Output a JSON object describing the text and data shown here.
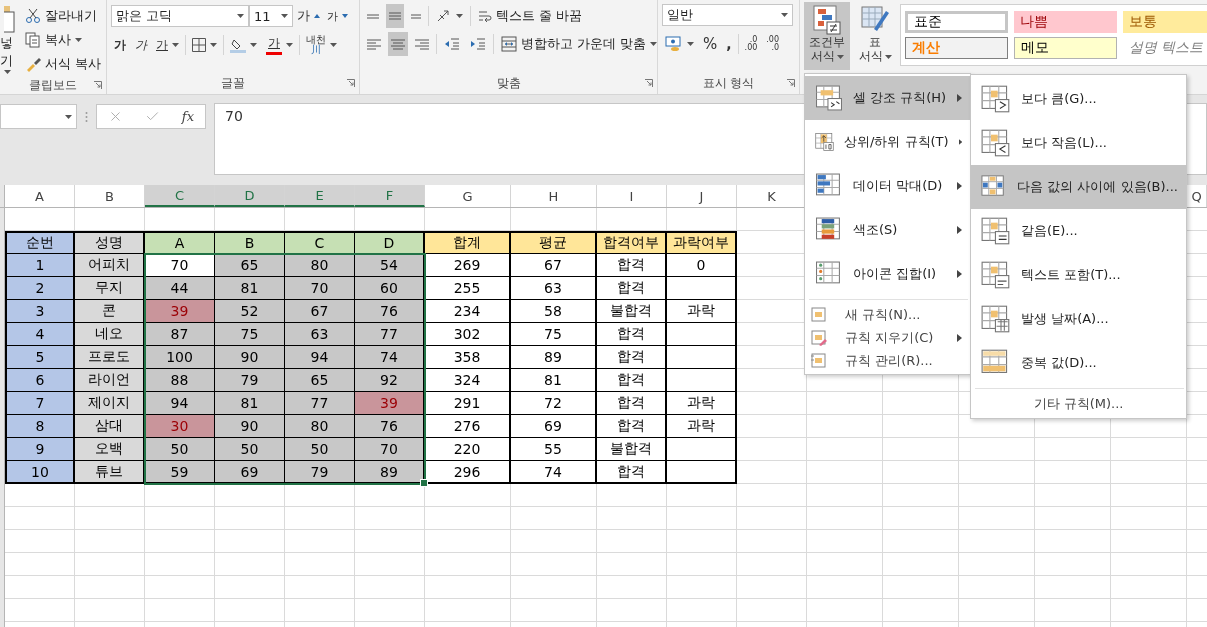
{
  "ribbon": {
    "clipboard": {
      "paste": "넣기",
      "cut": "잘라내기",
      "copy": "복사",
      "format_painter": "서식 복사",
      "label": "클립보드"
    },
    "font": {
      "font_name": "맑은 고딕",
      "font_size": "11",
      "grow": "가",
      "shrink": "가",
      "bold": "가",
      "italic": "가",
      "underline": "가",
      "font_color": "가",
      "phonetic": "내천",
      "phonetic_sub": "川",
      "label": "글꼴"
    },
    "alignment": {
      "vertical": [
        {
          "selected": false
        },
        {
          "selected": true
        },
        {
          "selected": false
        }
      ],
      "horizontal": [
        {
          "selected": false
        },
        {
          "selected": true
        },
        {
          "selected": false
        }
      ],
      "wrap_text": "텍스트 줄 바꿈",
      "merge_center": "병합하고 가운데 맞춤",
      "label": "맞춤"
    },
    "number": {
      "format": "일반",
      "percent": "%",
      "comma": ",",
      "increase_decimal": [
        ".0",
        ".00"
      ],
      "decrease_decimal": [
        ".00",
        ".0"
      ],
      "label": "표시 형식"
    },
    "styles": {
      "conditional_formatting": {
        "lines": [
          "조건부",
          "서식"
        ],
        "selected": true
      },
      "table_format": {
        "lines": [
          "표",
          "서식"
        ],
        "selected": false
      },
      "cell_styles": [
        {
          "label": "표준",
          "kind": "normal"
        },
        {
          "label": "나쁨",
          "kind": "bad"
        },
        {
          "label": "보통",
          "kind": "neutral"
        },
        {
          "label": "계산",
          "kind": "calculation"
        },
        {
          "label": "메모",
          "kind": "note"
        },
        {
          "label": "설명 텍스트",
          "kind": "explanatory"
        }
      ]
    }
  },
  "formula_bar": {
    "function_label": "fx",
    "value": "70"
  },
  "columns": [
    {
      "label": "A",
      "selected": false
    },
    {
      "label": "B",
      "selected": false
    },
    {
      "label": "C",
      "selected": true
    },
    {
      "label": "D",
      "selected": true
    },
    {
      "label": "E",
      "selected": true
    },
    {
      "label": "F",
      "selected": true
    },
    {
      "label": "G",
      "selected": false
    },
    {
      "label": "H",
      "selected": false
    },
    {
      "label": "I",
      "selected": false
    },
    {
      "label": "J",
      "selected": false
    },
    {
      "label": "K",
      "selected": false
    },
    {
      "label": "Q",
      "selected": false
    }
  ],
  "table": {
    "header": [
      {
        "label": "순번",
        "kind": "number"
      },
      {
        "label": "성명",
        "kind": "name"
      },
      {
        "label": "A",
        "kind": "score"
      },
      {
        "label": "B",
        "kind": "score"
      },
      {
        "label": "C",
        "kind": "score"
      },
      {
        "label": "D",
        "kind": "score"
      },
      {
        "label": "합계",
        "kind": "result"
      },
      {
        "label": "평균",
        "kind": "result"
      },
      {
        "label": "합격여부",
        "kind": "result"
      },
      {
        "label": "과락여부",
        "kind": "result"
      }
    ],
    "rows": [
      {
        "no": "1",
        "name": "어피치",
        "scores": [
          {
            "value": "70",
            "selected": true,
            "active": true,
            "highlighted": false
          },
          {
            "value": "65",
            "selected": true,
            "active": false,
            "highlighted": false
          },
          {
            "value": "80",
            "selected": true,
            "active": false,
            "highlighted": false
          },
          {
            "value": "54",
            "selected": true,
            "active": false,
            "highlighted": false
          }
        ],
        "total": "269",
        "average": "67",
        "pass": "합격",
        "fail": "0"
      },
      {
        "no": "2",
        "name": "무지",
        "scores": [
          {
            "value": "44",
            "selected": true,
            "active": false,
            "highlighted": false
          },
          {
            "value": "81",
            "selected": true,
            "active": false,
            "highlighted": false
          },
          {
            "value": "70",
            "selected": true,
            "active": false,
            "highlighted": false
          },
          {
            "value": "60",
            "selected": true,
            "active": false,
            "highlighted": false
          }
        ],
        "total": "255",
        "average": "63",
        "pass": "합격"
      },
      {
        "no": "3",
        "name": "콘",
        "scores": [
          {
            "value": "39",
            "selected": true,
            "active": false,
            "highlighted": true
          },
          {
            "value": "52",
            "selected": true,
            "active": false,
            "highlighted": false
          },
          {
            "value": "67",
            "selected": true,
            "active": false,
            "highlighted": false
          },
          {
            "value": "76",
            "selected": true,
            "active": false,
            "highlighted": false
          }
        ],
        "total": "234",
        "average": "58",
        "pass": "불합격",
        "fail": "과락"
      },
      {
        "no": "4",
        "name": "네오",
        "scores": [
          {
            "value": "87",
            "selected": true,
            "active": false,
            "highlighted": false
          },
          {
            "value": "75",
            "selected": true,
            "active": false,
            "highlighted": false
          },
          {
            "value": "63",
            "selected": true,
            "active": false,
            "highlighted": false
          },
          {
            "value": "77",
            "selected": true,
            "active": false,
            "highlighted": false
          }
        ],
        "total": "302",
        "average": "75",
        "pass": "합격"
      },
      {
        "no": "5",
        "name": "프로도",
        "scores": [
          {
            "value": "100",
            "selected": true,
            "active": false,
            "highlighted": false
          },
          {
            "value": "90",
            "selected": true,
            "active": false,
            "highlighted": false
          },
          {
            "value": "94",
            "selected": true,
            "active": false,
            "highlighted": false
          },
          {
            "value": "74",
            "selected": true,
            "active": false,
            "highlighted": false
          }
        ],
        "total": "358",
        "average": "89",
        "pass": "합격"
      },
      {
        "no": "6",
        "name": "라이언",
        "scores": [
          {
            "value": "88",
            "selected": true,
            "active": false,
            "highlighted": false
          },
          {
            "value": "79",
            "selected": true,
            "active": false,
            "highlighted": false
          },
          {
            "value": "65",
            "selected": true,
            "active": false,
            "highlighted": false
          },
          {
            "value": "92",
            "selected": true,
            "active": false,
            "highlighted": false
          }
        ],
        "total": "324",
        "average": "81",
        "pass": "합격"
      },
      {
        "no": "7",
        "name": "제이지",
        "scores": [
          {
            "value": "94",
            "selected": true,
            "active": false,
            "highlighted": false
          },
          {
            "value": "81",
            "selected": true,
            "active": false,
            "highlighted": false
          },
          {
            "value": "77",
            "selected": true,
            "active": false,
            "highlighted": false
          },
          {
            "value": "39",
            "selected": true,
            "active": false,
            "highlighted": true
          }
        ],
        "total": "291",
        "average": "72",
        "pass": "합격",
        "fail": "과락"
      },
      {
        "no": "8",
        "name": "삼대",
        "scores": [
          {
            "value": "30",
            "selected": true,
            "active": false,
            "highlighted": true
          },
          {
            "value": "90",
            "selected": true,
            "active": false,
            "highlighted": false
          },
          {
            "value": "80",
            "selected": true,
            "active": false,
            "highlighted": false
          },
          {
            "value": "76",
            "selected": true,
            "active": false,
            "highlighted": false
          }
        ],
        "total": "276",
        "average": "69",
        "pass": "합격",
        "fail": "과락"
      },
      {
        "no": "9",
        "name": "오백",
        "scores": [
          {
            "value": "50",
            "selected": true,
            "active": false,
            "highlighted": false
          },
          {
            "value": "50",
            "selected": true,
            "active": false,
            "highlighted": false
          },
          {
            "value": "50",
            "selected": true,
            "active": false,
            "highlighted": false
          },
          {
            "value": "70",
            "selected": true,
            "active": false,
            "highlighted": false
          }
        ],
        "total": "220",
        "average": "55",
        "pass": "불합격"
      },
      {
        "no": "10",
        "name": "튜브",
        "scores": [
          {
            "value": "59",
            "selected": true,
            "active": false,
            "highlighted": false
          },
          {
            "value": "69",
            "selected": true,
            "active": false,
            "highlighted": false
          },
          {
            "value": "79",
            "selected": true,
            "active": false,
            "highlighted": false
          },
          {
            "value": "89",
            "selected": true,
            "active": false,
            "highlighted": false
          }
        ],
        "total": "296",
        "average": "74",
        "pass": "합격"
      }
    ]
  },
  "menu": {
    "items": [
      {
        "label": "셀 강조 규칙(H)",
        "kind": "large",
        "submenu": true,
        "selected": true
      },
      {
        "label": "상위/하위 규칙(T)",
        "kind": "large",
        "submenu": true,
        "selected": false
      },
      {
        "label": "데이터 막대(D)",
        "kind": "large",
        "submenu": true,
        "selected": false
      },
      {
        "label": "색조(S)",
        "kind": "large",
        "submenu": true,
        "selected": false
      },
      {
        "label": "아이콘 집합(I)",
        "kind": "large",
        "submenu": true,
        "selected": false
      },
      {
        "label": "새 규칙(N)...",
        "kind": "small",
        "submenu": false,
        "selected": false
      },
      {
        "label": "규칙 지우기(C)",
        "kind": "small",
        "submenu": true,
        "selected": false
      },
      {
        "label": "규칙 관리(R)...",
        "kind": "small",
        "submenu": false,
        "selected": false
      }
    ]
  },
  "submenu": {
    "items": [
      {
        "label": "보다 큼(G)...",
        "kind": "large",
        "selected": false
      },
      {
        "label": "보다 작음(L)...",
        "kind": "large",
        "selected": false
      },
      {
        "label": "다음 값의 사이에 있음(B)...",
        "kind": "large",
        "selected": true
      },
      {
        "label": "같음(E)...",
        "kind": "large",
        "selected": false
      },
      {
        "label": "텍스트 포함(T)...",
        "kind": "large",
        "selected": false
      },
      {
        "label": "발생 날짜(A)...",
        "kind": "large",
        "selected": false
      },
      {
        "label": "중복 값(D)...",
        "kind": "large",
        "selected": false
      },
      {
        "label": "기타 규칙(M)...",
        "kind": "footer",
        "selected": false
      }
    ]
  }
}
